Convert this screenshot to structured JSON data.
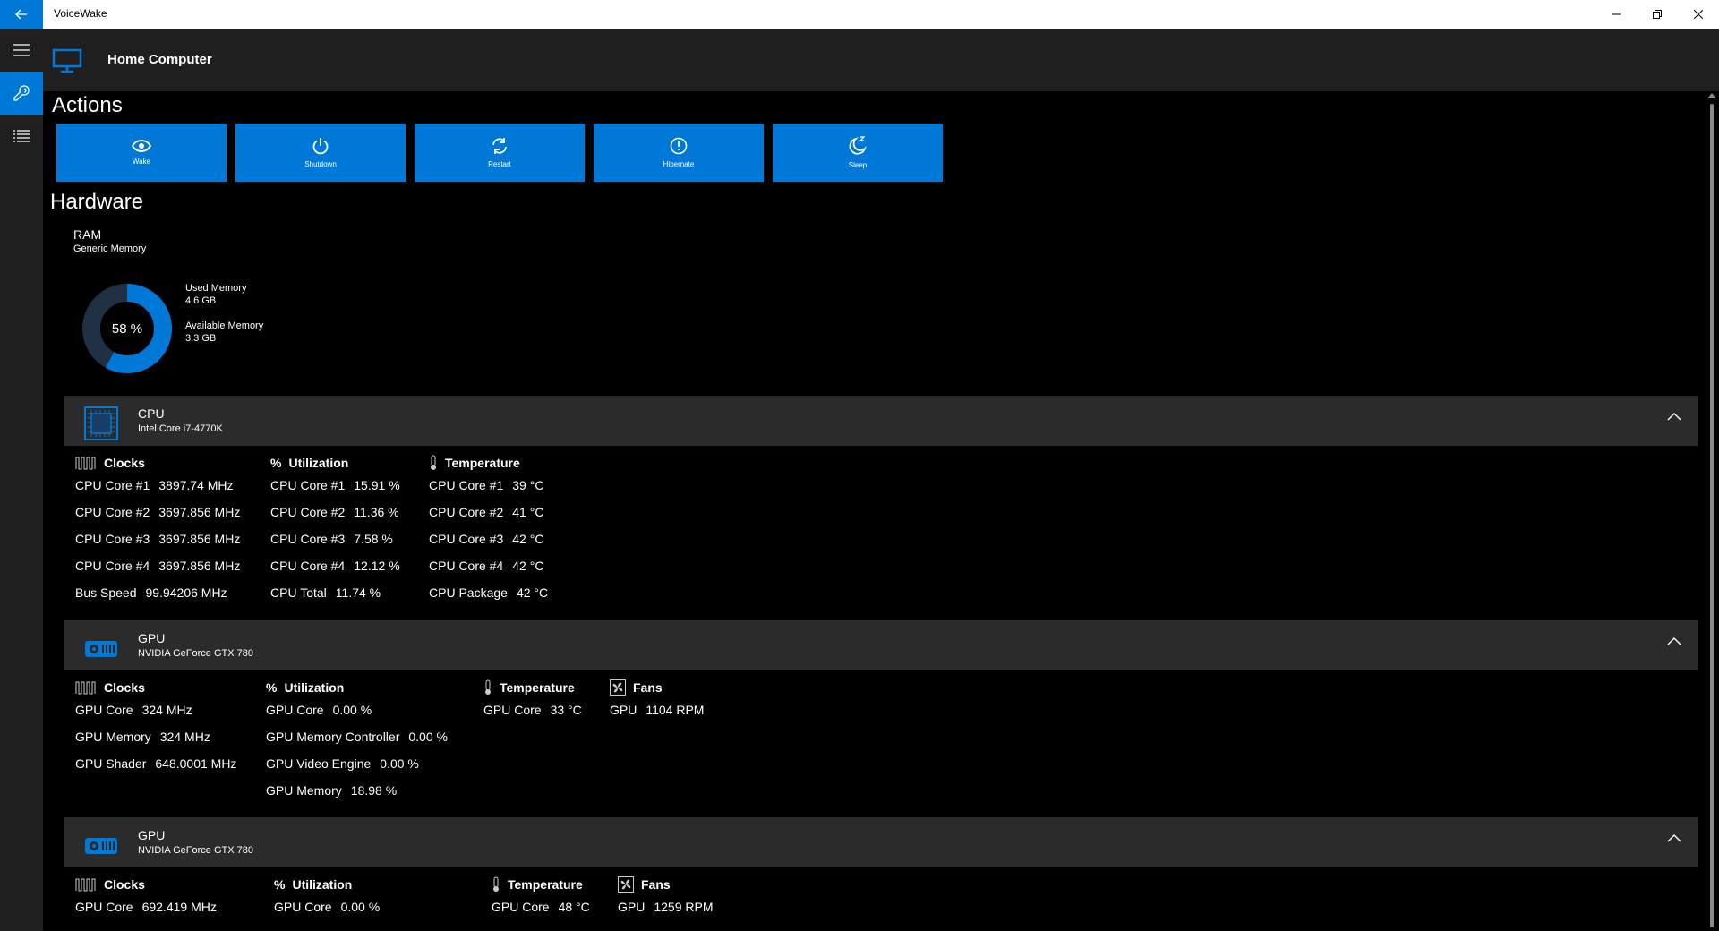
{
  "app": {
    "title": "VoiceWake",
    "accent": "#0078d7"
  },
  "header": {
    "title": "Home Computer",
    "icon": "monitor-icon"
  },
  "rail": {
    "items": [
      {
        "icon": "hamburger-menu-icon"
      },
      {
        "icon": "wrench-icon",
        "active": true
      },
      {
        "icon": "list-icon"
      }
    ]
  },
  "actions": {
    "title": "Actions",
    "buttons": [
      {
        "label": "Wake",
        "icon": "eye-icon"
      },
      {
        "label": "Shutdown",
        "icon": "power-icon"
      },
      {
        "label": "Restart",
        "icon": "refresh-icon"
      },
      {
        "label": "Hibernate",
        "icon": "hibernate-icon"
      },
      {
        "label": "Sleep",
        "icon": "moon-icon"
      }
    ]
  },
  "hardware": {
    "title": "Hardware",
    "ram": {
      "name": "RAM",
      "model": "Generic Memory",
      "percent_label": "58 %",
      "percent": 58,
      "used_label": "Used Memory",
      "used_value": "4.6 GB",
      "available_label": "Available Memory",
      "available_value": "3.3 GB"
    },
    "cpu": {
      "name": "CPU",
      "model": "Intel Core i7-4770K",
      "clocks": {
        "title": "Clocks",
        "rows": [
          {
            "k": "CPU Core #1",
            "v": "3897.74 MHz"
          },
          {
            "k": "CPU Core #2",
            "v": "3697.856 MHz"
          },
          {
            "k": "CPU Core #3",
            "v": "3697.856 MHz"
          },
          {
            "k": "CPU Core #4",
            "v": "3697.856 MHz"
          },
          {
            "k": "Bus Speed",
            "v": "99.94206 MHz"
          }
        ]
      },
      "utilization": {
        "title": "Utilization",
        "rows": [
          {
            "k": "CPU Core #1",
            "v": "15.91 %"
          },
          {
            "k": "CPU Core #2",
            "v": "11.36 %"
          },
          {
            "k": "CPU Core #3",
            "v": "7.58 %"
          },
          {
            "k": "CPU Core #4",
            "v": "12.12 %"
          },
          {
            "k": "CPU Total",
            "v": "11.74 %"
          }
        ]
      },
      "temperature": {
        "title": "Temperature",
        "rows": [
          {
            "k": "CPU Core #1",
            "v": "39 °C"
          },
          {
            "k": "CPU Core #2",
            "v": "41 °C"
          },
          {
            "k": "CPU Core #3",
            "v": "42 °C"
          },
          {
            "k": "CPU Core #4",
            "v": "42 °C"
          },
          {
            "k": "CPU Package",
            "v": "42 °C"
          }
        ]
      }
    },
    "gpu1": {
      "name": "GPU",
      "model": "NVIDIA GeForce GTX 780",
      "clocks": {
        "title": "Clocks",
        "rows": [
          {
            "k": "GPU Core",
            "v": "324 MHz"
          },
          {
            "k": "GPU Memory",
            "v": "324 MHz"
          },
          {
            "k": "GPU Shader",
            "v": "648.0001 MHz"
          }
        ]
      },
      "utilization": {
        "title": "Utilization",
        "rows": [
          {
            "k": "GPU Core",
            "v": "0.00 %"
          },
          {
            "k": "GPU Memory Controller",
            "v": "0.00 %"
          },
          {
            "k": "GPU Video Engine",
            "v": "0.00 %"
          },
          {
            "k": "GPU Memory",
            "v": "18.98 %"
          }
        ]
      },
      "temperature": {
        "title": "Temperature",
        "rows": [
          {
            "k": "GPU Core",
            "v": "33 °C"
          }
        ]
      },
      "fans": {
        "title": "Fans",
        "rows": [
          {
            "k": "GPU",
            "v": "1104 RPM"
          }
        ]
      }
    },
    "gpu2": {
      "name": "GPU",
      "model": "NVIDIA GeForce GTX 780",
      "clocks": {
        "title": "Clocks",
        "rows": [
          {
            "k": "GPU Core",
            "v": "692.419 MHz"
          }
        ]
      },
      "utilization": {
        "title": "Utilization",
        "rows": [
          {
            "k": "GPU Core",
            "v": "0.00 %"
          }
        ]
      },
      "temperature": {
        "title": "Temperature",
        "rows": [
          {
            "k": "GPU Core",
            "v": "48 °C"
          }
        ]
      },
      "fans": {
        "title": "Fans",
        "rows": [
          {
            "k": "GPU",
            "v": "1259 RPM"
          }
        ]
      }
    }
  }
}
